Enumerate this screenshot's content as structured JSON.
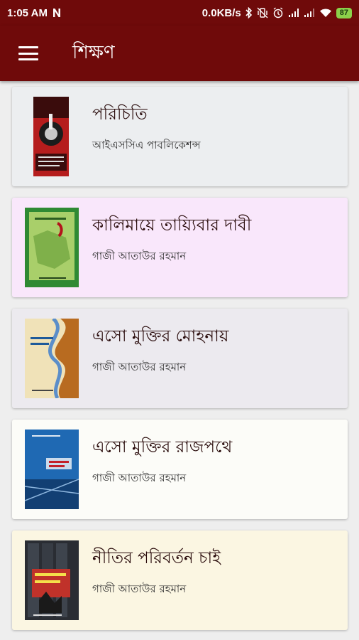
{
  "status_bar": {
    "time": "1:05 AM",
    "network_speed": "0.0KB/s",
    "battery": "87"
  },
  "app_bar": {
    "title": "শিক্ষণ"
  },
  "books": [
    {
      "title": "পরিচিতি",
      "author": "আইএসসিএ পাবলিকেশন্স",
      "bg": "#eceef0"
    },
    {
      "title": "কালিমায়ে তায়্যিবার দাবী",
      "author": "গাজী আতাউর রহমান",
      "bg": "#f9e7fb"
    },
    {
      "title": "এসো মুক্তির মোহনায়",
      "author": "গাজী আতাউর রহমান",
      "bg": "#eceaef"
    },
    {
      "title": "এসো মুক্তির রাজপথে",
      "author": "গাজী আতাউর রহমান",
      "bg": "#fcfcf8"
    },
    {
      "title": "নীতির পরিবর্তন চাই",
      "author": "গাজী আতাউর রহমান",
      "bg": "#fbf6e2"
    }
  ]
}
